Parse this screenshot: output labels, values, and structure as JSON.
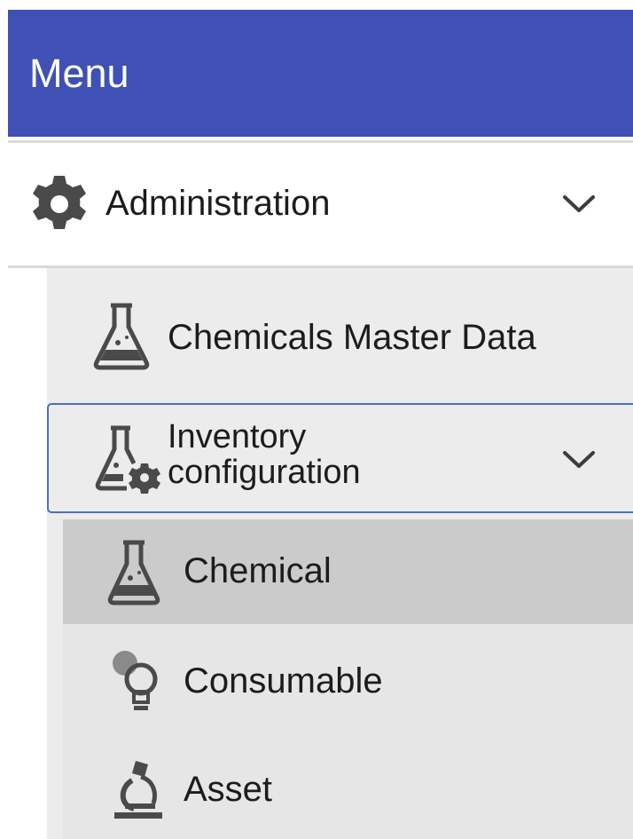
{
  "menu": {
    "title": "Menu"
  },
  "admin": {
    "label": "Administration",
    "icon": "gear-icon"
  },
  "items": {
    "chemicals_master": {
      "label": "Chemicals Master Data",
      "icon": "flask-icon"
    },
    "inventory_config": {
      "label": "Inventory configuration",
      "icon": "flask-gear-icon"
    }
  },
  "subitems": {
    "chemical": {
      "label": "Chemical",
      "icon": "flask-icon",
      "selected": true
    },
    "consumable": {
      "label": "Consumable",
      "icon": "lightbulb-icon"
    },
    "asset": {
      "label": "Asset",
      "icon": "microscope-icon"
    }
  },
  "colors": {
    "header_bg": "#3f51b5",
    "active_border": "#4a70b8",
    "selected_bg": "#cbcbcb",
    "icon": "#4a4a4a"
  }
}
